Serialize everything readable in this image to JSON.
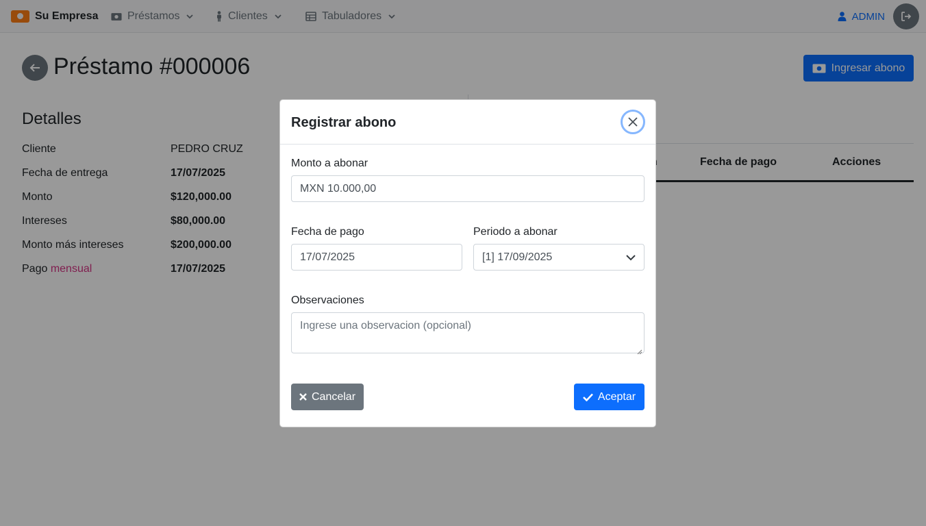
{
  "navbar": {
    "brand": "Su Empresa",
    "items": [
      {
        "label": "Préstamos"
      },
      {
        "label": "Clientes"
      },
      {
        "label": "Tabuladores"
      }
    ],
    "user": "ADMIN"
  },
  "page": {
    "title": "Préstamo #000006",
    "action_button": "Ingresar abono"
  },
  "details": {
    "title": "Detalles",
    "rows": [
      {
        "label": "Cliente",
        "value": "PEDRO CRUZ"
      },
      {
        "label": "Fecha de entrega",
        "value": "17/07/2025"
      },
      {
        "label": "Monto",
        "value": "$120,000.00"
      },
      {
        "label": "Intereses",
        "value": "$80,000.00"
      },
      {
        "label": "Monto más intereses",
        "value": "$200,000.00"
      }
    ],
    "payment_row": {
      "label_prefix": "Pago ",
      "label_highlight": "mensual",
      "value": "17/07/2025"
    }
  },
  "table": {
    "partial_header": "n",
    "headers": [
      "Fecha de pago",
      "Acciones"
    ]
  },
  "modal": {
    "title": "Registrar abono",
    "monto_label": "Monto a abonar",
    "monto_value": "MXN 10.000,00",
    "fecha_label": "Fecha de pago",
    "fecha_value": "17/07/2025",
    "periodo_label": "Periodo a abonar",
    "periodo_value": "[1] 17/09/2025",
    "obs_label": "Observaciones",
    "obs_placeholder": "Ingrese una observacion (opcional)",
    "cancel_label": "Cancelar",
    "accept_label": "Aceptar"
  },
  "colors": {
    "primary": "#0d6efd",
    "secondary": "#6c757d",
    "brand": "#fd7e14",
    "highlight": "#d63384"
  }
}
